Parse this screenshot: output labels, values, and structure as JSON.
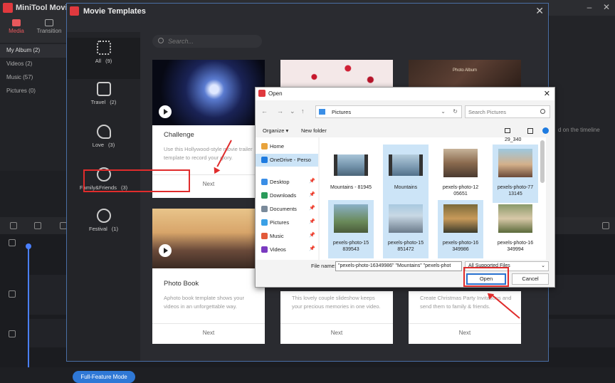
{
  "app": {
    "title": "MiniTool MovieMa",
    "tabs": [
      "Media",
      "Transition"
    ]
  },
  "library": {
    "items": [
      "My Album (2)",
      "Videos (2)",
      "Music (57)",
      "Pictures (0)"
    ]
  },
  "right_hint": "d on the timeline",
  "modal": {
    "title": "Movie Templates",
    "search_placeholder": "Search...",
    "categories": [
      {
        "label": "All",
        "count": "(9)",
        "icon": "grid-icon"
      },
      {
        "label": "Travel",
        "count": "(2)",
        "icon": "suitcase-icon"
      },
      {
        "label": "Love",
        "count": "(3)",
        "icon": "heart-icon"
      },
      {
        "label": "Family&Friends",
        "count": "(3)",
        "icon": "people-icon"
      },
      {
        "label": "Festival",
        "count": "(1)",
        "icon": "balloon-icon"
      }
    ],
    "full_mode_label": "Full-Feature Mode",
    "cards": [
      {
        "title": "Challenge",
        "desc": "Use this Hollywood-style movie trailer template to record your glory.",
        "next": "Next"
      },
      {
        "title": "Photo Book",
        "desc": "Aphoto book template shows your videos in an unforgettable way.",
        "next": "Next"
      },
      {
        "title": "",
        "desc": "This lovely couple slideshow keeps your precious memories in one video.",
        "next": "Next"
      },
      {
        "title": "",
        "desc": "Create Christmas Party Invitations and send them to family & friends.",
        "next": "Next"
      },
      {
        "title": "",
        "desc": "",
        "next": ""
      },
      {
        "title": "",
        "desc": "",
        "next": ""
      }
    ],
    "thumb_caption": "Photo Album"
  },
  "dialog": {
    "title": "Open",
    "path": "Pictures",
    "search_placeholder": "Search Pictures",
    "organize": "Organize",
    "new_folder": "New folder",
    "nav": [
      {
        "label": "Home",
        "icon": "home-icon",
        "color": "#e8a33c"
      },
      {
        "label": "OneDrive - Perso",
        "icon": "cloud-icon",
        "color": "#1e7be0",
        "selected": true
      },
      {
        "label": "Desktop",
        "icon": "desktop-icon",
        "color": "#3a8ee6"
      },
      {
        "label": "Downloads",
        "icon": "download-icon",
        "color": "#2a9a5a"
      },
      {
        "label": "Documents",
        "icon": "document-icon",
        "color": "#7a8a9a"
      },
      {
        "label": "Pictures",
        "icon": "pictures-icon",
        "color": "#3aa0e6"
      },
      {
        "label": "Music",
        "icon": "music-icon",
        "color": "#e25a3a"
      },
      {
        "label": "Videos",
        "icon": "video-icon",
        "color": "#7a3ac0"
      }
    ],
    "top_label": "29_340",
    "files": [
      {
        "label": "Mountains - 81945",
        "selected": false,
        "kind": "video"
      },
      {
        "label": "Mountains",
        "selected": true,
        "kind": "video"
      },
      {
        "label": "pexels-photo-12 05651",
        "selected": false,
        "kind": "photo"
      },
      {
        "label": "pexels-photo-77 13145",
        "selected": true,
        "kind": "photo"
      },
      {
        "label": "pexels-photo-15 839543",
        "selected": true,
        "kind": "photo"
      },
      {
        "label": "pexels-photo-15 851472",
        "selected": true,
        "kind": "photo"
      },
      {
        "label": "pexels-photo-16 349986",
        "selected": true,
        "kind": "photo"
      },
      {
        "label": "pexels-photo-16 349994",
        "selected": false,
        "kind": "photo"
      }
    ],
    "file_name_label": "File name:",
    "file_name_value": "\"pexels-photo-16349986\" \"Mountains\" \"pexels-phot",
    "filter": "All Supported Files",
    "open": "Open",
    "cancel": "Cancel"
  },
  "colors": {
    "accent": "#e9585c",
    "highlight": "#e02c2c",
    "primary_blue": "#2f78d6"
  }
}
